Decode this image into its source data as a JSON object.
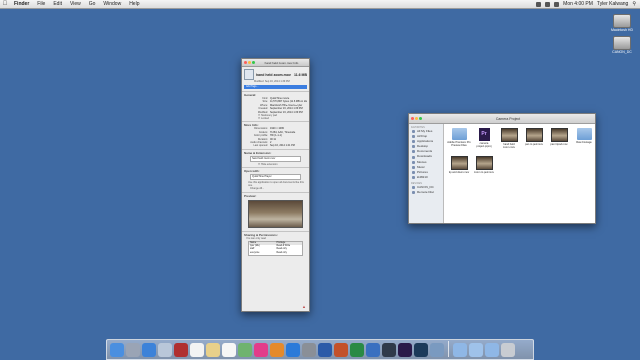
{
  "menubar": {
    "app_name": "Finder",
    "items": [
      "File",
      "Edit",
      "View",
      "Go",
      "Window",
      "Help"
    ],
    "clock": "Mon 4:00 PM",
    "user": "Tyler Kalwang"
  },
  "desktop": {
    "drives": [
      {
        "label": "Macintosh HD"
      },
      {
        "label": "CANON_DC"
      }
    ]
  },
  "info_window": {
    "title": "hand held zoom.mov Info",
    "file_name": "hand held zoom.mov",
    "size": "11.6 MB",
    "modified": "Modified: Sep 16, 2014 1:39 PM",
    "tags_placeholder": "Add Tags...",
    "general_title": "General:",
    "general": [
      {
        "k": "Kind:",
        "v": "QuickTime movie"
      },
      {
        "k": "Size:",
        "v": "11,573,867 bytes (11.6 MB on disk)"
      },
      {
        "k": "Where:",
        "v": "Macintosh HD ▸ Users ▸ tyler"
      },
      {
        "k": "Created:",
        "v": "September 16, 2014 1:39 PM"
      },
      {
        "k": "Modified:",
        "v": "September 16, 2014 1:39 PM"
      }
    ],
    "checkboxes": [
      "Stationery pad",
      "Locked"
    ],
    "more_info_title": "More Info:",
    "more_info": [
      {
        "k": "Dimensions:",
        "v": "1920 × 1080"
      },
      {
        "k": "Codecs:",
        "v": "H.264, AAC, Timecode"
      },
      {
        "k": "Color profile:",
        "v": "HD (1-1-1)"
      },
      {
        "k": "Duration:",
        "v": "00:11"
      },
      {
        "k": "Audio channels:",
        "v": "2"
      },
      {
        "k": "Last opened:",
        "v": "Sep 16, 2014 1:41 PM"
      }
    ],
    "name_ext_title": "Name & Extension:",
    "name_value": "hand held zoom.mov",
    "hide_ext": "Hide extension",
    "open_with_title": "Open with:",
    "open_with_app": "QuickTime Player",
    "open_with_note": "Use this application to open all documents like this one.",
    "change_all": "Change All...",
    "preview_title": "Preview:",
    "sharing_title": "Sharing & Permissions:",
    "sharing_note": "You can only read",
    "perm_header": [
      "Name",
      "Privilege"
    ],
    "perm_rows": [
      [
        "tyler (Me)",
        "Read & Write"
      ],
      [
        "staff",
        "Read only"
      ],
      [
        "everyone",
        "Read only"
      ]
    ]
  },
  "finder_window": {
    "title": "Camera Project",
    "sidebar": {
      "favorites_label": "FAVORITES",
      "favorites": [
        "All My Files",
        "AirDrop",
        "Applications",
        "Desktop",
        "Documents",
        "Downloads",
        "Movies",
        "Music",
        "Pictures",
        "kt48210"
      ],
      "devices_label": "DEVICES",
      "devices": [
        "CANON_DC",
        "Remote Disc"
      ]
    },
    "items": [
      {
        "name": "Adobe Premiere Pro Preview Files",
        "kind": "folder"
      },
      {
        "name": "camera project.prproj",
        "kind": "pr"
      },
      {
        "name": "hand held zoom.mov",
        "kind": "vid"
      },
      {
        "name": "pan to ped.mov",
        "kind": "vid"
      },
      {
        "name": "pan tripod.mov",
        "kind": "vid"
      },
      {
        "name": "Raw Footage",
        "kind": "folder"
      },
      {
        "name": "tip and down.mov",
        "kind": "vid"
      },
      {
        "name": "zoom to ped.mov",
        "kind": "vid"
      }
    ]
  },
  "dock": {
    "apps": [
      {
        "name": "finder-icon",
        "color": "#4a8fe0"
      },
      {
        "name": "launchpad-icon",
        "color": "#9aa4b5"
      },
      {
        "name": "safari-icon",
        "color": "#3c82d9"
      },
      {
        "name": "mail-icon",
        "color": "#b9c7d9"
      },
      {
        "name": "photo-booth-icon",
        "color": "#b03030"
      },
      {
        "name": "calendar-icon",
        "color": "#f3f3f3"
      },
      {
        "name": "notes-icon",
        "color": "#e8d08a"
      },
      {
        "name": "reminders-icon",
        "color": "#f6f6f6"
      },
      {
        "name": "maps-icon",
        "color": "#6fb36f"
      },
      {
        "name": "itunes-icon",
        "color": "#e23c8a"
      },
      {
        "name": "ibooks-icon",
        "color": "#e58a2b"
      },
      {
        "name": "app-store-icon",
        "color": "#2b7ad9"
      },
      {
        "name": "system-preferences-icon",
        "color": "#8a8f97"
      },
      {
        "name": "word-icon",
        "color": "#2b5aa8"
      },
      {
        "name": "powerpoint-icon",
        "color": "#c3512a"
      },
      {
        "name": "excel-icon",
        "color": "#2a8a45"
      },
      {
        "name": "outlook-icon",
        "color": "#3a70c0"
      },
      {
        "name": "quicktime-icon",
        "color": "#2f3a4a"
      },
      {
        "name": "premiere-icon",
        "color": "#2a1a4a"
      },
      {
        "name": "photoshop-icon",
        "color": "#1c3a5a"
      },
      {
        "name": "preview-icon",
        "color": "#7a9ac0"
      }
    ],
    "stacks": [
      {
        "name": "applications-stack-icon",
        "color": "#8fb7e6"
      },
      {
        "name": "documents-stack-icon",
        "color": "#9fc2ea"
      },
      {
        "name": "downloads-stack-icon",
        "color": "#8fb7e6"
      },
      {
        "name": "trash-icon",
        "color": "#c8ccd2"
      }
    ]
  }
}
